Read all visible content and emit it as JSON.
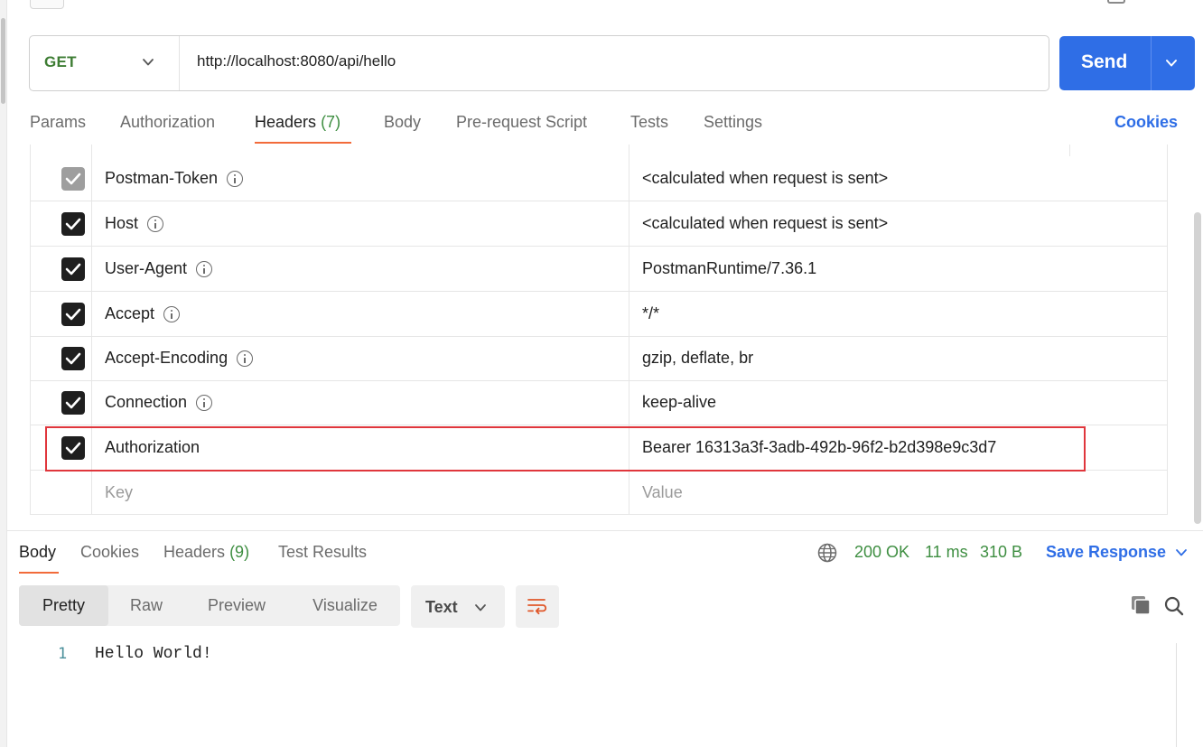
{
  "request": {
    "method": "GET",
    "url": "http://localhost:8080/api/hello",
    "send_label": "Send"
  },
  "request_tabs": [
    {
      "label": "Params"
    },
    {
      "label": "Authorization"
    },
    {
      "label": "Headers",
      "count": "(7)"
    },
    {
      "label": "Body"
    },
    {
      "label": "Pre-request Script"
    },
    {
      "label": "Tests"
    },
    {
      "label": "Settings"
    }
  ],
  "cookies_link": "Cookies",
  "headers": [
    {
      "key": "Postman-Token",
      "value": "<calculated when request is sent>",
      "checked": true,
      "disabled": true,
      "info": true
    },
    {
      "key": "Host",
      "value": "<calculated when request is sent>",
      "checked": true,
      "disabled": false,
      "info": true
    },
    {
      "key": "User-Agent",
      "value": "PostmanRuntime/7.36.1",
      "checked": true,
      "disabled": false,
      "info": true
    },
    {
      "key": "Accept",
      "value": "*/*",
      "checked": true,
      "disabled": false,
      "info": true
    },
    {
      "key": "Accept-Encoding",
      "value": "gzip, deflate, br",
      "checked": true,
      "disabled": false,
      "info": true
    },
    {
      "key": "Connection",
      "value": "keep-alive",
      "checked": true,
      "disabled": false,
      "info": true
    },
    {
      "key": "Authorization",
      "value": "Bearer 16313a3f-3adb-492b-96f2-b2d398e9c3d7",
      "checked": true,
      "disabled": false,
      "info": false,
      "highlighted": true
    }
  ],
  "new_header": {
    "key_placeholder": "Key",
    "value_placeholder": "Value"
  },
  "response_tabs": [
    {
      "label": "Body"
    },
    {
      "label": "Cookies"
    },
    {
      "label": "Headers",
      "count": "(9)"
    },
    {
      "label": "Test Results"
    }
  ],
  "response_status": {
    "status": "200 OK",
    "time": "11 ms",
    "size": "310 B"
  },
  "save_response_label": "Save Response",
  "view_modes": [
    "Pretty",
    "Raw",
    "Preview",
    "Visualize"
  ],
  "active_view_mode": "Pretty",
  "format": "Text",
  "response_body": {
    "line_number": "1",
    "text": "Hello World!"
  },
  "colors": {
    "accent": "#2f6ee6",
    "active_tab_underline": "#f26b3a",
    "status_ok": "#3e8e41",
    "highlight_border": "#e0363c"
  }
}
